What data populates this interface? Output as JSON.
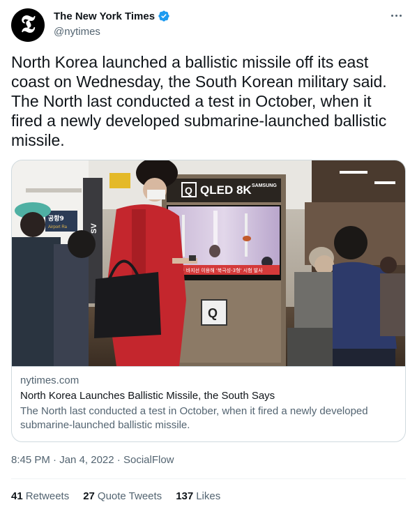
{
  "author": {
    "display_name": "The New York Times",
    "handle": "@nytimes",
    "avatar_glyph": "𝕿",
    "verified": true,
    "verified_color": "#1d9bf0"
  },
  "tweet": {
    "text": "North Korea launched a ballistic missile off its east coast on Wednesday, the South Korean military said. The North last conducted a test in October, when it fired a newly developed submarine-launched ballistic missile."
  },
  "card": {
    "domain": "nytimes.com",
    "title": "North Korea Launches Ballistic Missile, the South Says",
    "description": "The North last conducted a test in October, when it fired a newly developed submarine-launched ballistic missile.",
    "image": {
      "tv_brand": "QLED 8K",
      "tv_maker": "SAMSUNG",
      "sign_text": "공항9",
      "sign_sub": "Airport Ra",
      "pillar_text": "SV",
      "ticker_text": "1 수중 바지선 이용해 '북극성-3형' 시험 발사",
      "q_label": "Q"
    }
  },
  "meta": {
    "time": "8:45 PM",
    "date": "Jan 4, 2022",
    "source": "SocialFlow",
    "separator": "·"
  },
  "stats": {
    "retweets_count": "41",
    "retweets_label": "Retweets",
    "quotes_count": "27",
    "quotes_label": "Quote Tweets",
    "likes_count": "137",
    "likes_label": "Likes"
  }
}
